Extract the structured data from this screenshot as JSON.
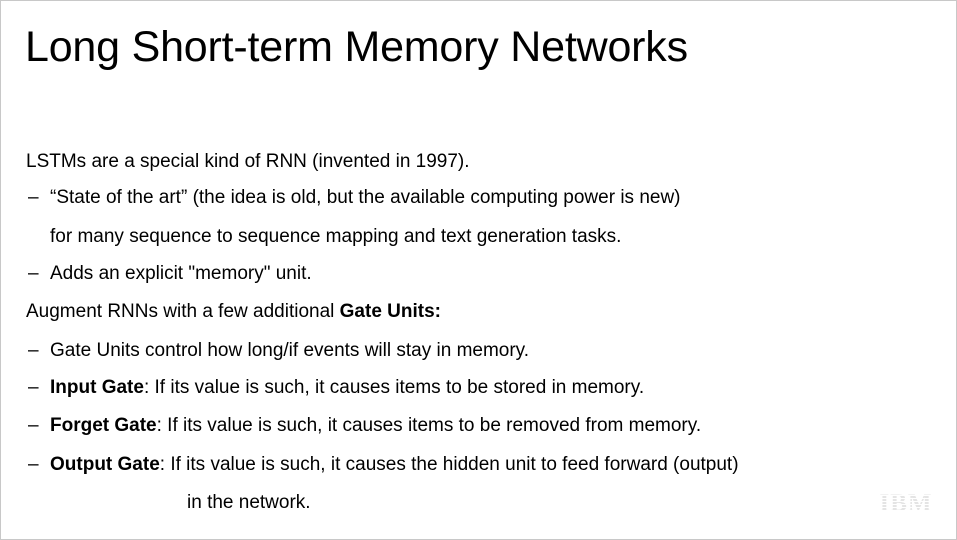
{
  "slide": {
    "title": "Long Short-term Memory Networks",
    "intro": "LSTMs are a special kind of RNN (invented in 1997).",
    "dash_glyph": "–",
    "bullet1": {
      "line1": "“State of the art” (the idea is old, but the available computing power is new)",
      "line2": "for many sequence to sequence mapping and text generation tasks."
    },
    "bullet2": "Adds an explicit \"memory\" unit.",
    "augment": {
      "text": "Augment RNNs with a few additional ",
      "bold": "Gate Units:"
    },
    "gates": {
      "control": "Gate Units control how long/if events will stay in memory.",
      "input": {
        "name": "Input Gate",
        "desc": ": If its value is such, it causes items to be stored in memory."
      },
      "forget": {
        "name": "Forget Gate",
        "desc": ": If its value is such, it causes items to be removed from memory."
      },
      "output": {
        "name": "Output Gate",
        "desc": ": If its value is such, it causes the hidden unit to feed forward (output)",
        "cont": "in the network."
      }
    },
    "logo": "IBM",
    "logo_color": "#1f1f1f"
  }
}
